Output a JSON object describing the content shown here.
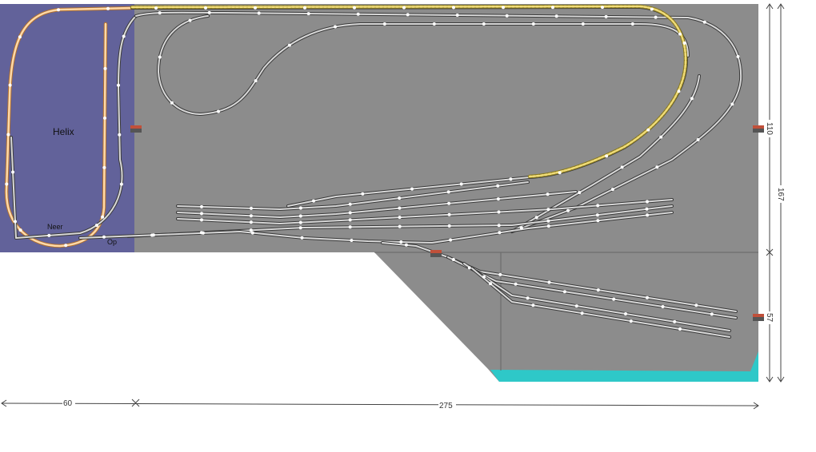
{
  "labels": {
    "helix": "Helix",
    "down": "Neer",
    "up": "Op"
  },
  "dimensions": {
    "left_width": "60",
    "right_width": "275",
    "upper_height": "110",
    "total_height": "167",
    "lower_height": "57"
  },
  "colors": {
    "board": "#8c8c8c",
    "helix_area": "#62629a",
    "water": "#2ec8c8",
    "background": "#ffffff",
    "helix_track": "#f5c49a",
    "highlight_track": "#e8c860"
  },
  "icons": [
    "signal-icon",
    "signal-icon",
    "signal-icon",
    "signal-icon"
  ]
}
